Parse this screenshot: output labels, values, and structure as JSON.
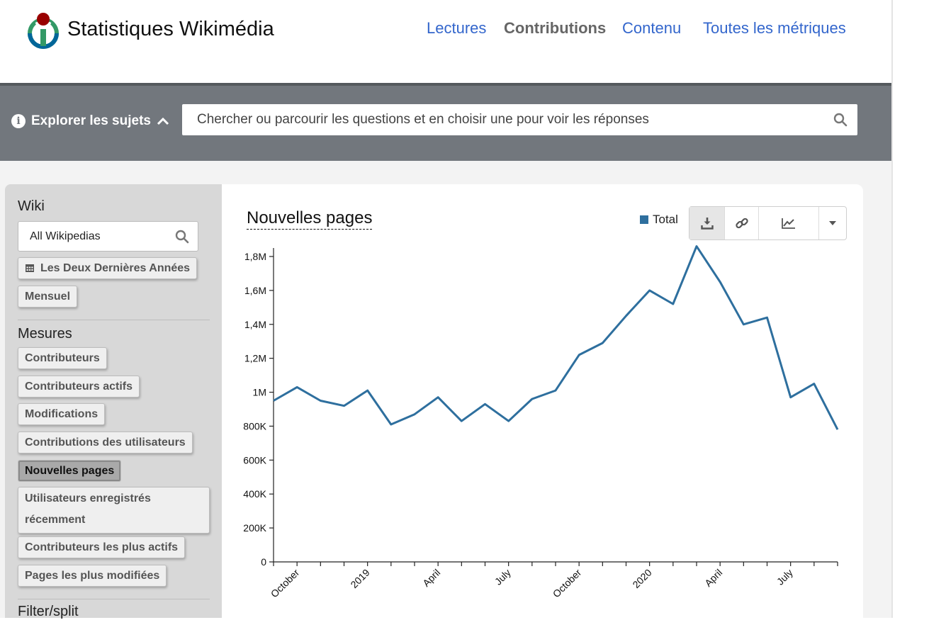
{
  "header": {
    "brand": "Statistiques Wikimédia",
    "nav": [
      {
        "label": "Lectures",
        "active": false
      },
      {
        "label": "Contributions",
        "active": true
      },
      {
        "label": "Contenu",
        "active": false
      },
      {
        "label": "Toutes les métriques",
        "active": false
      }
    ]
  },
  "search": {
    "explore_label": "Explorer les sujets",
    "placeholder": "Chercher ou parcourir les questions et en choisir une pour voir les réponses"
  },
  "sidebar": {
    "wiki_title": "Wiki",
    "wiki_value": "All Wikipedias",
    "time_range": "Les Deux Dernières Années",
    "granularity": "Mensuel",
    "metrics_title": "Mesures",
    "metrics": [
      {
        "label": "Contributeurs",
        "selected": false
      },
      {
        "label": "Contributeurs actifs",
        "selected": false
      },
      {
        "label": "Modifications",
        "selected": false
      },
      {
        "label": "Contributions des utilisateurs",
        "selected": false
      },
      {
        "label": "Nouvelles pages",
        "selected": true
      },
      {
        "label": "Utilisateurs enregistrés récemment",
        "selected": false
      },
      {
        "label": "Contributeurs les plus actifs",
        "selected": false
      },
      {
        "label": "Pages les plus modifiées",
        "selected": false
      }
    ],
    "filter_title": "Filter/split"
  },
  "chart": {
    "title": "Nouvelles pages",
    "legend": "Total",
    "line_color": "#2e6f9e"
  },
  "chart_data": {
    "type": "line",
    "title": "Nouvelles pages",
    "xlabel": "",
    "ylabel": "",
    "ylim": [
      0,
      1850000
    ],
    "y_ticks": [
      0,
      200000,
      400000,
      600000,
      800000,
      1000000,
      1200000,
      1400000,
      1600000,
      1800000
    ],
    "y_tick_labels": [
      "0",
      "200K",
      "400K",
      "600K",
      "800K",
      "1M",
      "1,2M",
      "1,4M",
      "1,6M",
      "1,8M"
    ],
    "x_tick_labels": [
      "October",
      "2019",
      "April",
      "July",
      "October",
      "2020",
      "April",
      "July"
    ],
    "x": [
      "2018-09",
      "2018-10",
      "2018-11",
      "2018-12",
      "2019-01",
      "2019-02",
      "2019-03",
      "2019-04",
      "2019-05",
      "2019-06",
      "2019-07",
      "2019-08",
      "2019-09",
      "2019-10",
      "2019-11",
      "2019-12",
      "2020-01",
      "2020-02",
      "2020-03",
      "2020-04",
      "2020-05",
      "2020-06",
      "2020-07",
      "2020-08",
      "2020-09"
    ],
    "series": [
      {
        "name": "Total",
        "values": [
          950000,
          1030000,
          950000,
          920000,
          1010000,
          810000,
          870000,
          970000,
          830000,
          930000,
          830000,
          960000,
          1010000,
          1220000,
          1290000,
          1450000,
          1600000,
          1520000,
          1860000,
          1650000,
          1400000,
          1440000,
          970000,
          1050000,
          780000
        ]
      }
    ],
    "grid": false,
    "legend_position": "top-right"
  }
}
